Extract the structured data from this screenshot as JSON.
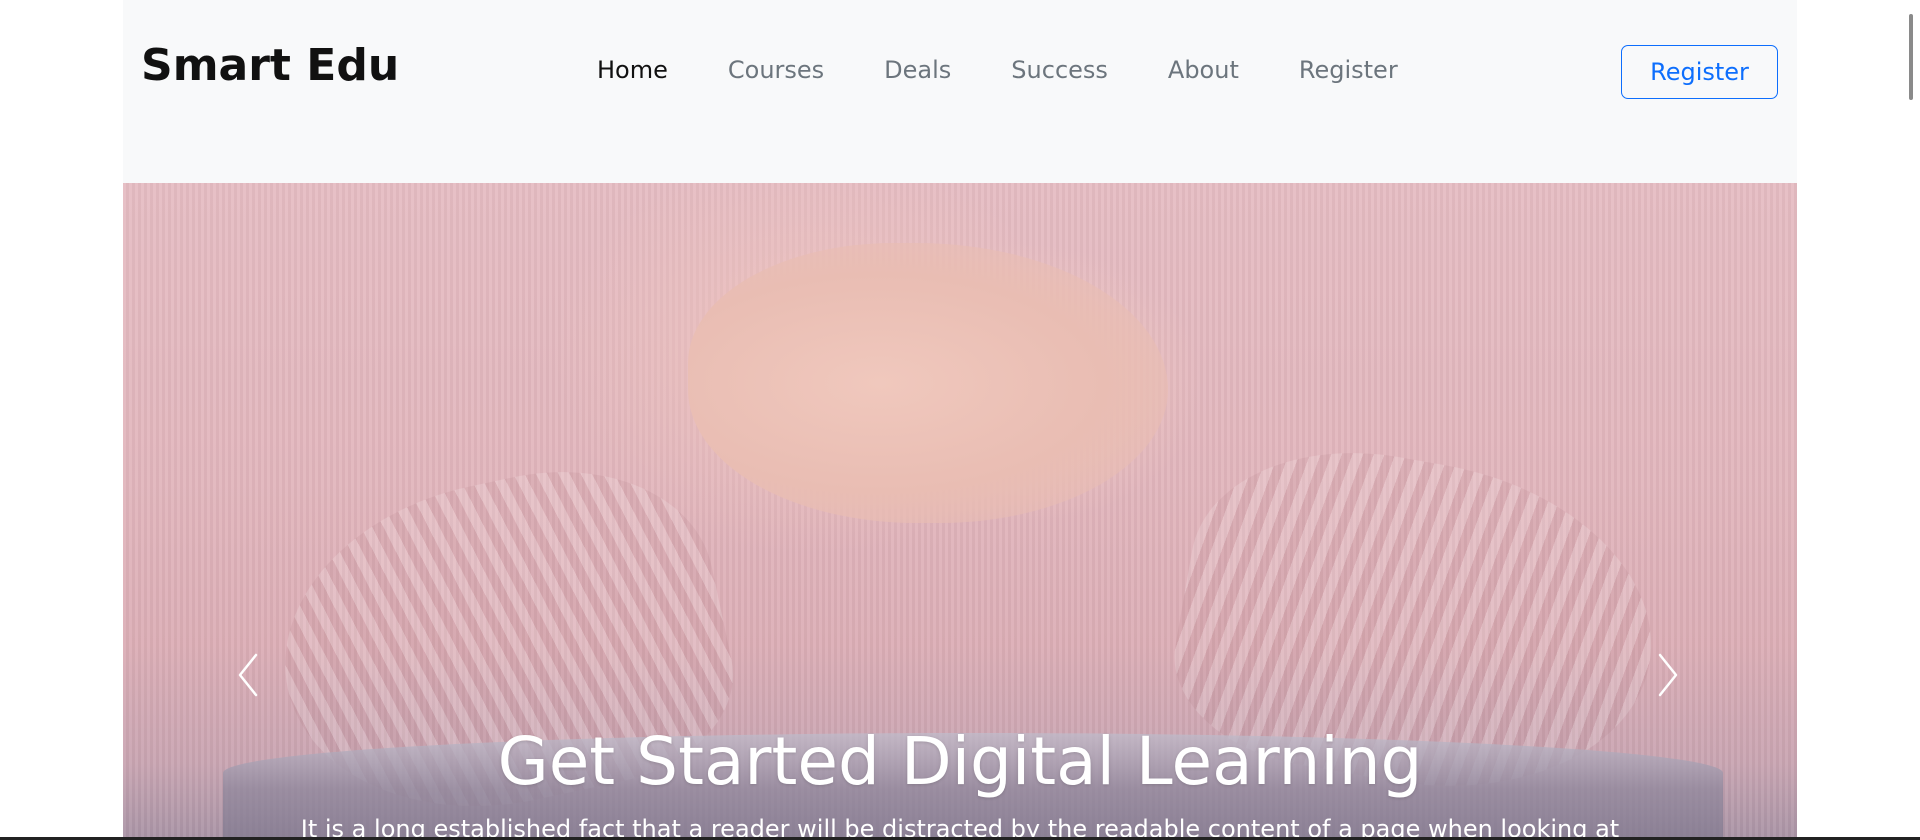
{
  "navbar": {
    "brand": "Smart Edu",
    "links": [
      {
        "label": "Home",
        "active": true
      },
      {
        "label": "Courses",
        "active": false
      },
      {
        "label": "Deals",
        "active": false
      },
      {
        "label": "Success",
        "active": false
      },
      {
        "label": "About",
        "active": false
      },
      {
        "label": "Register",
        "active": false
      }
    ],
    "cta_label": "Register"
  },
  "hero": {
    "title": "Get Started Digital Learning",
    "text": "It is a long established fact that a reader will be distracted by the readable content of a page when looking at",
    "prev_icon": "chevron-left-icon",
    "next_icon": "chevron-right-icon"
  },
  "colors": {
    "accent": "#0d6efd",
    "navbar_bg": "#f8f9fa",
    "nav_link": "#6c757d",
    "nav_link_active": "#111111"
  }
}
